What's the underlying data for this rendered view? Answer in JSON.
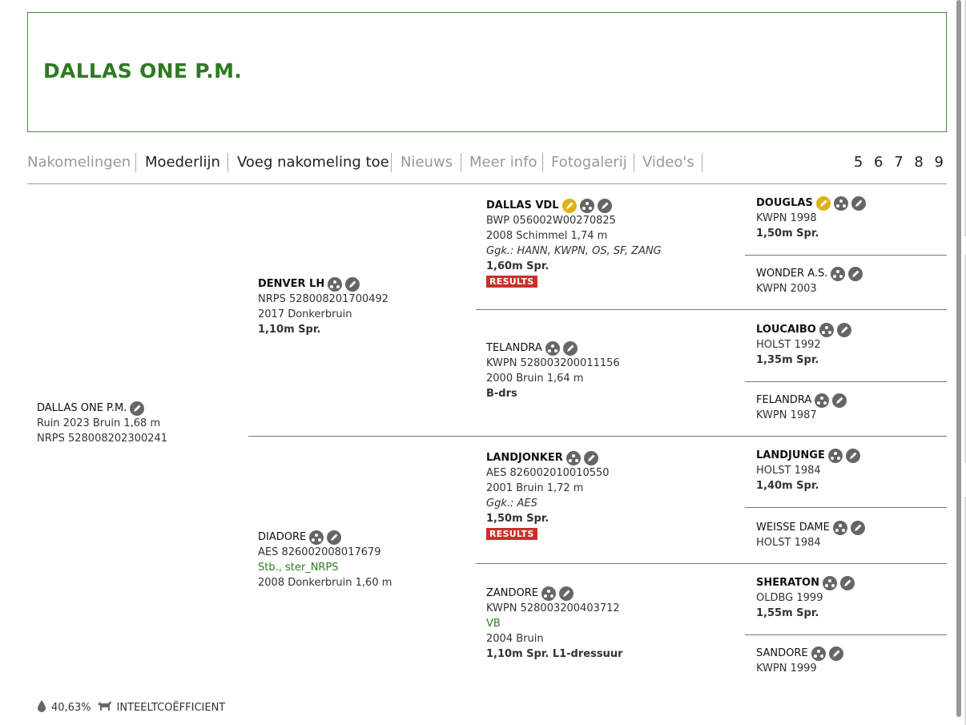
{
  "title": "DALLAS ONE P.M.",
  "tabs": [
    "Nakomelingen",
    "Moederlijn",
    "Voeg nakomeling toe",
    "Nieuws",
    "Meer info",
    "Fotogalerij",
    "Video's"
  ],
  "pages": "5 6 7 8 9",
  "horse": {
    "name": "DALLAS ONE  P.M.",
    "line1": "Ruin 2023 Bruin 1,68 m",
    "line2": "NRPS 528008202300241"
  },
  "sire": {
    "name": "DENVER LH",
    "reg": "NRPS 528008201700492",
    "desc": "2017 Donkerbruin",
    "result": "1,10m Spr."
  },
  "dam": {
    "name": "DIADORE",
    "reg": "AES 826002008017679",
    "stb": "Stb., ster_NRPS",
    "desc": "2008 Donkerbruin 1,60 m"
  },
  "ss": {
    "name": "DALLAS VDL",
    "reg": "BWP 056002W00270825",
    "desc": "2008 Schimmel 1,74 m",
    "ggk": "Ggk.: HANN, KWPN, OS, SF, ZANG",
    "result": "1,60m Spr.",
    "badge": "RESULTS"
  },
  "sd": {
    "name": "TELANDRA",
    "reg": "KWPN 528003200011156",
    "desc": "2000 Bruin 1,64 m",
    "result": "B-drs"
  },
  "ds": {
    "name": "LANDJONKER",
    "reg": "AES 826002010010550",
    "desc": "2001 Bruin 1,72 m",
    "ggk": "Ggk.: AES",
    "result": "1,50m Spr.",
    "badge": "RESULTS"
  },
  "dd": {
    "name": "ZANDORE",
    "reg": "KWPN 528003200403712",
    "stb": "VB",
    "desc": "2004 Bruin",
    "result": "1,10m Spr. L1-dressuur"
  },
  "g1": {
    "name": "DOUGLAS",
    "reg": "KWPN 1998",
    "result": "1,50m Spr."
  },
  "g2": {
    "name": "WONDER A.S.",
    "reg": "KWPN 2003"
  },
  "g3": {
    "name": "LOUCAIBO",
    "reg": "HOLST 1992",
    "result": "1,35m Spr."
  },
  "g4": {
    "name": "FELANDRA",
    "reg": "KWPN 1987"
  },
  "g5": {
    "name": "LANDJUNGE",
    "reg": "HOLST 1984",
    "result": "1,40m Spr."
  },
  "g6": {
    "name": "WEISSE DAME",
    "reg": "HOLST 1984"
  },
  "g7": {
    "name": "SHERATON",
    "reg": "OLDBG 1999",
    "result": "1,55m Spr."
  },
  "g8": {
    "name": "SANDORE",
    "reg": "KWPN 1999"
  },
  "inbreeding": {
    "percent": "40,63%",
    "label": "INTEELTCOËFFICIENT"
  },
  "colors": {
    "brand_green": "#2e7a22",
    "results_red": "#c9302c",
    "icon_gold": "#e0b21a",
    "icon_gray": "#666666"
  }
}
